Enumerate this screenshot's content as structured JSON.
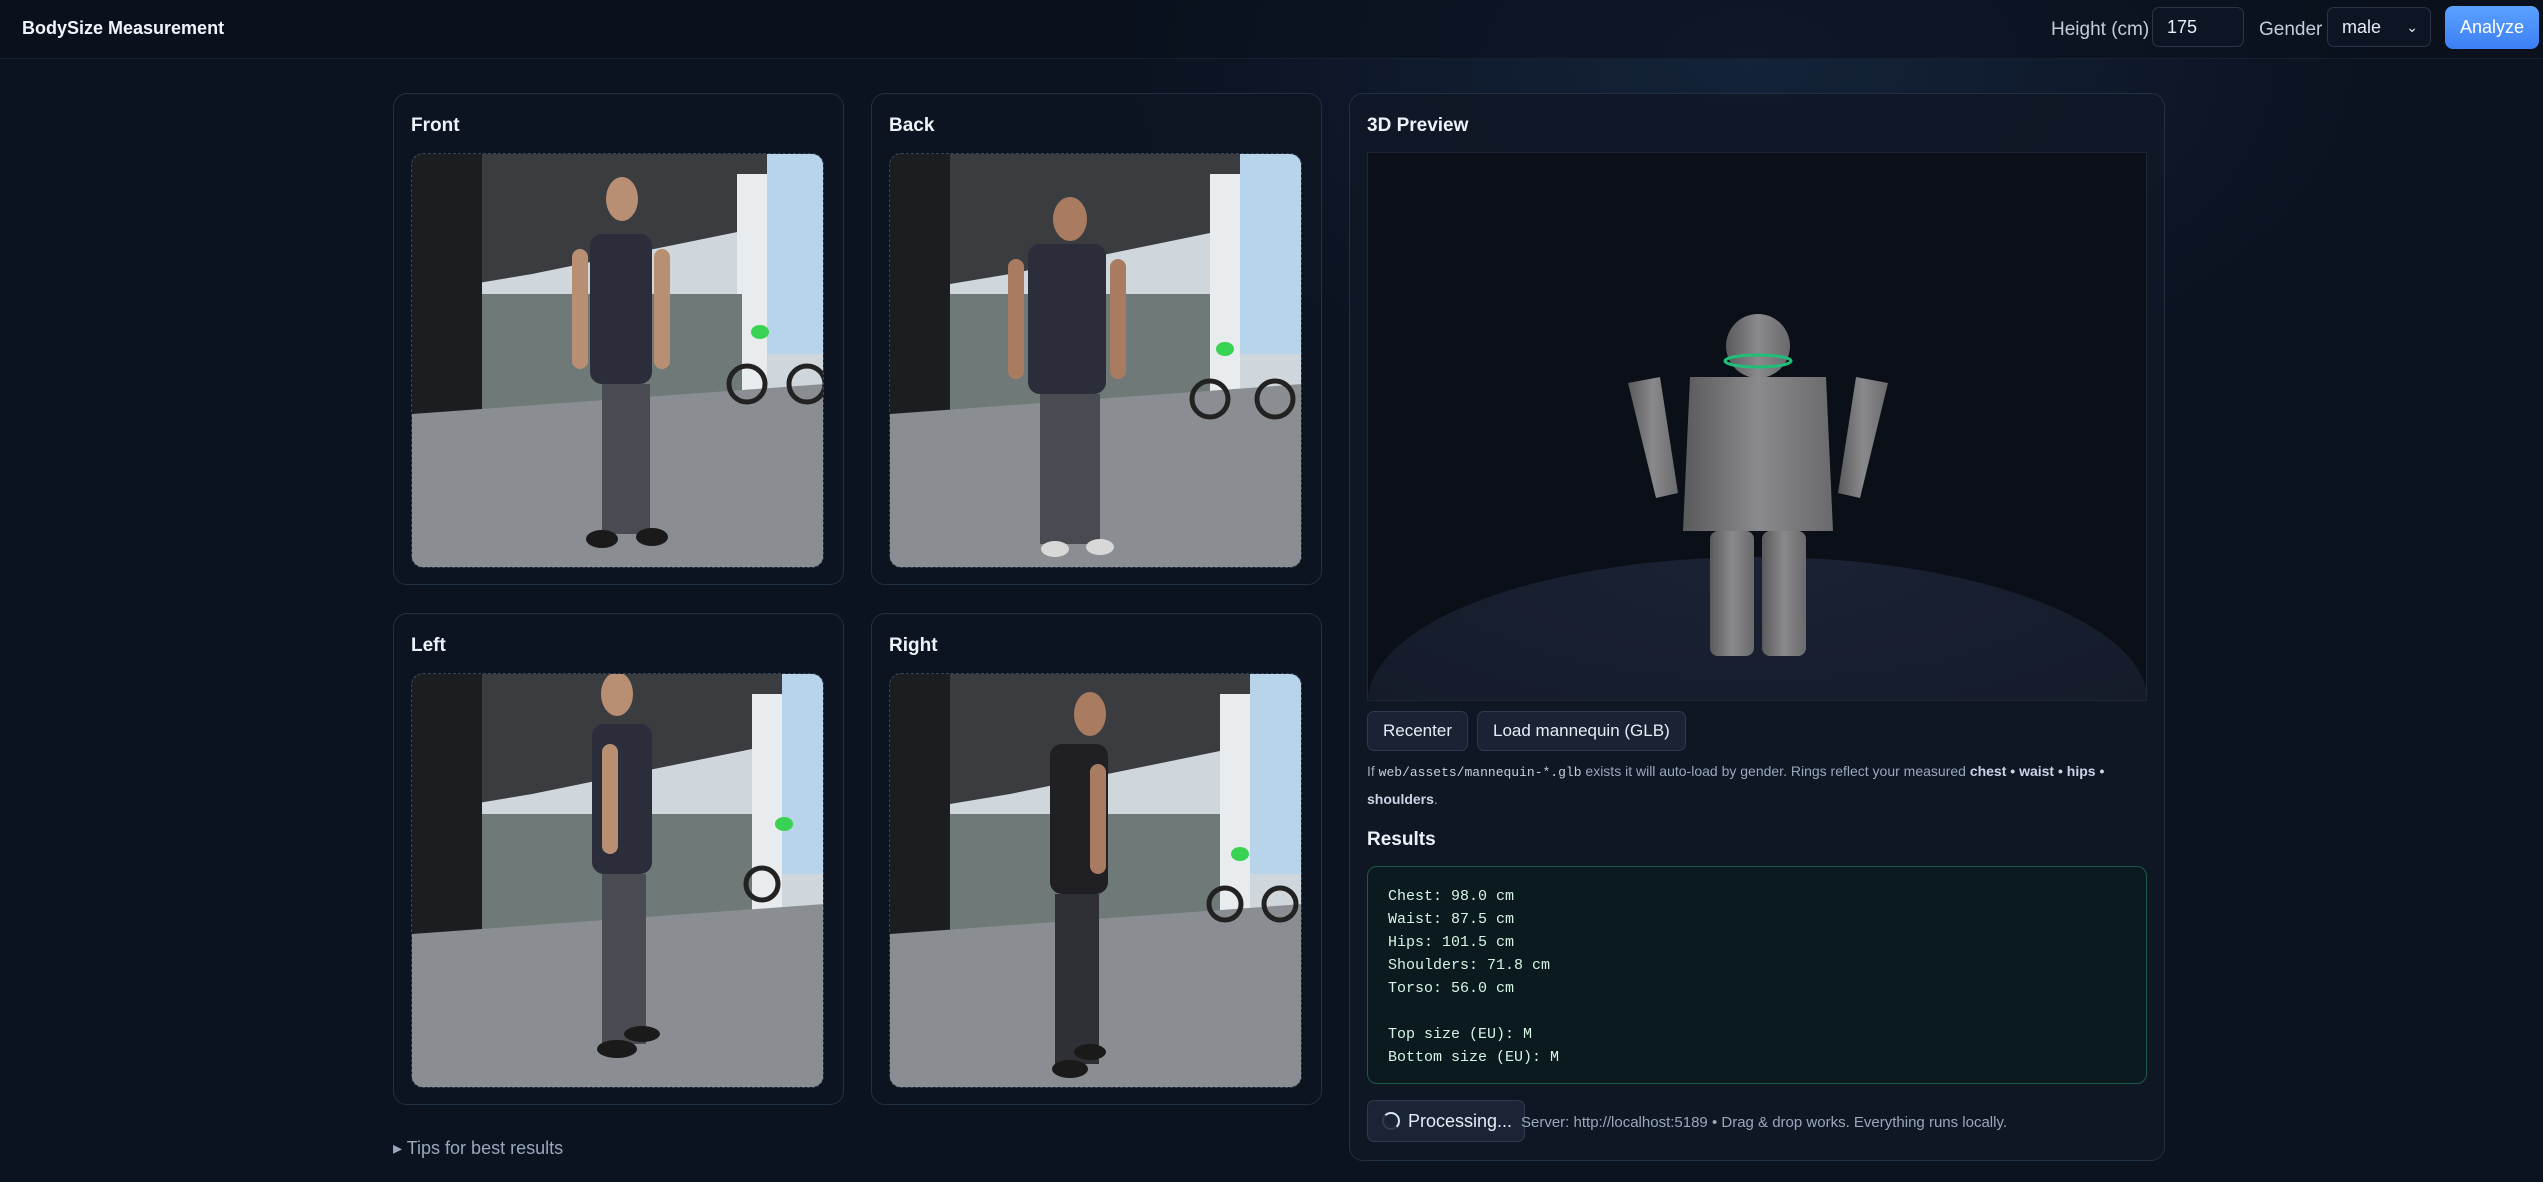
{
  "app": {
    "title": "BodySize Measurement"
  },
  "controls": {
    "height_label": "Height (cm)",
    "height_value": "175",
    "gender_label": "Gender",
    "gender_value": "male",
    "analyze_label": "Analyze"
  },
  "photos": [
    {
      "label": "Front"
    },
    {
      "label": "Back"
    },
    {
      "label": "Left"
    },
    {
      "label": "Right"
    }
  ],
  "preview": {
    "title": "3D Preview",
    "recenter_label": "Recenter",
    "load_label": "Load mannequin (GLB)",
    "hint_prefix": "If",
    "hint_code": "web/assets/mannequin-*.glb",
    "hint_middle": "exists it will auto-load by gender. Rings reflect your measured",
    "hint_chest": "chest",
    "hint_waist": "waist",
    "hint_hips": "hips",
    "hint_shoulders": "shoulders",
    "hint_sep": "•",
    "hint_end": "."
  },
  "results": {
    "title": "Results",
    "lines": [
      "Chest: 98.0 cm",
      "Waist: 87.5 cm",
      "Hips: 101.5 cm",
      "Shoulders: 71.8 cm",
      "Torso: 56.0 cm",
      "",
      "Top size (EU): M",
      "Bottom size (EU): M"
    ]
  },
  "status": {
    "processing_label": "Processing...",
    "server_text": "Server: http://localhost:5189 • Drag & drop works. Everything runs locally."
  },
  "tips": {
    "label": "▸ Tips for best results"
  },
  "colors": {
    "accent": "#4a8ff8",
    "ring": "#1fbf7a",
    "results_border": "#1e5a4a"
  }
}
